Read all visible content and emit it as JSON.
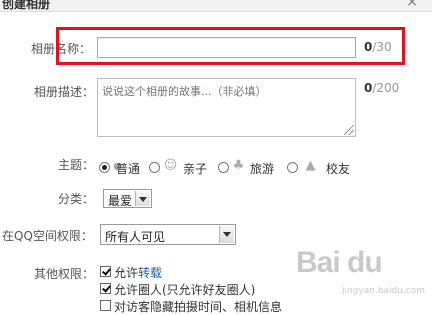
{
  "dialog": {
    "title": "创建相册",
    "close_glyph": "×"
  },
  "album_name": {
    "label": "相册名称：",
    "value": "",
    "placeholder": "",
    "count_current": "0",
    "count_max": "/30"
  },
  "album_description": {
    "label": "相册描述：",
    "placeholder": "说说这个相册的故事...（非必填）",
    "count_current": "0",
    "count_max": "/200"
  },
  "theme": {
    "label": "主题：",
    "options": [
      {
        "label": "普通",
        "icon": "circle-icon",
        "selected": true
      },
      {
        "label": "亲子",
        "icon": "baby-face-icon",
        "selected": false
      },
      {
        "label": "旅游",
        "icon": "palm-tree-icon",
        "selected": false
      },
      {
        "label": "校友",
        "icon": "graduation-cap-icon",
        "selected": false
      }
    ]
  },
  "category": {
    "label": "分类：",
    "selected": "最爱"
  },
  "qzone_permission": {
    "label": "在QQ空间权限：",
    "selected": "所有人可见"
  },
  "other_permissions": {
    "label": "其他权限：",
    "options": [
      {
        "prefix": "允许",
        "link": "转载",
        "checked": true
      },
      {
        "prefix": "允许圈人(只允许好友圈人)",
        "link": "",
        "checked": true
      },
      {
        "prefix": "对访客隐藏拍摄时间、相机信息",
        "link": "",
        "checked": false
      }
    ]
  },
  "watermark": {
    "logo": "Bai du",
    "sub": "jingyan.baidu.com"
  },
  "colors": {
    "highlight": "#e3101d",
    "link": "#1f5fa8"
  }
}
